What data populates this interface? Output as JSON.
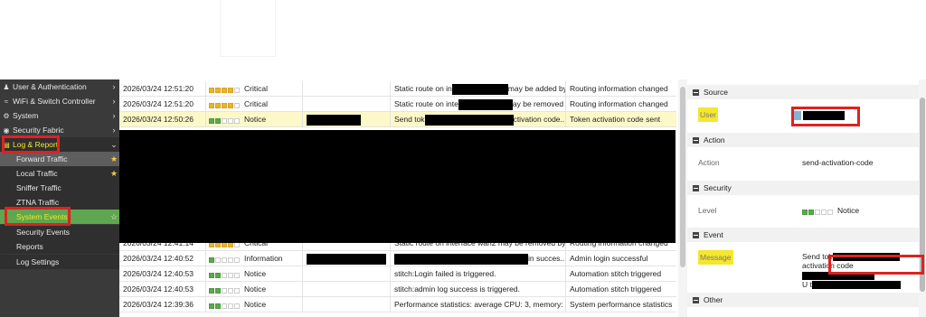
{
  "sidebar": {
    "items": [
      {
        "label": "User & Authentication",
        "icon": "user-icon",
        "has_chevron": true
      },
      {
        "label": "WiFi & Switch Controller",
        "icon": "wifi-icon",
        "has_chevron": true
      },
      {
        "label": "System",
        "icon": "gear-icon",
        "has_chevron": true
      },
      {
        "label": "Security Fabric",
        "icon": "fabric-icon",
        "has_chevron": true
      },
      {
        "label": "Log & Report",
        "icon": "chart-icon",
        "has_chevron": true
      }
    ],
    "sub_items": [
      {
        "label": "Forward Traffic",
        "starred": true
      },
      {
        "label": "Local Traffic",
        "starred": true
      },
      {
        "label": "Sniffer Traffic",
        "starred": false
      },
      {
        "label": "ZTNA Traffic",
        "starred": false
      },
      {
        "label": "System Events",
        "starred": true
      },
      {
        "label": "Security Events",
        "starred": false
      },
      {
        "label": "Reports",
        "starred": false
      },
      {
        "label": "Log Settings",
        "starred": false
      }
    ]
  },
  "events": {
    "rows": [
      {
        "date": "2026/03/24 12:51:20",
        "level": "Critical",
        "bars": 4,
        "user": "",
        "message_a": "Static route on in",
        "message_b": "may be added by he...",
        "action": "Routing information changed"
      },
      {
        "date": "2026/03/24 12:51:20",
        "level": "Critical",
        "bars": 4,
        "user": "",
        "message_a": "Static route on inte",
        "message_b": "ay be removed by ...",
        "action": "Routing information changed"
      },
      {
        "date": "2026/03/24 12:50:26",
        "level": "Notice",
        "bars": 2,
        "user": "",
        "message_a": "Send tok",
        "message_b": "ctivation code...",
        "action": "Token activation code sent"
      },
      {
        "date": "2026/03/24 12:41:14",
        "level": "Critical",
        "bars": 4,
        "user": "",
        "message_a": "Static route on interface wan2 may be removed by ...",
        "message_b": "",
        "action": "Routing information changed"
      },
      {
        "date": "2026/03/24 12:40:52",
        "level": "Information",
        "bars": 1,
        "user": "",
        "message_a": "",
        "message_b": "in succes...",
        "action": "Admin login successful"
      },
      {
        "date": "2026/03/24 12:40:53",
        "level": "Notice",
        "bars": 2,
        "user": "",
        "message_a": "stitch:Login failed is triggered.",
        "message_b": "",
        "action": "Automation stitch triggered"
      },
      {
        "date": "2026/03/24 12:40:53",
        "level": "Notice",
        "bars": 2,
        "user": "",
        "message_a": "stitch:admin log success is triggered.",
        "message_b": "",
        "action": "Automation stitch triggered"
      },
      {
        "date": "2026/03/24 12:39:36",
        "level": "Notice",
        "bars": 2,
        "user": "",
        "message_a": "Performance statistics: average CPU: 3, memory: 2...",
        "message_b": "",
        "action": "System performance statistics"
      }
    ]
  },
  "details": {
    "source_title": "Source",
    "user_label": "User",
    "action_title": "Action",
    "action_label": "Action",
    "action_value": "send-activation-code",
    "security_title": "Security",
    "level_label": "Level",
    "level_value": "Notice",
    "event_title": "Event",
    "message_label": "Message",
    "message_line1": "Send tok",
    "message_line2": "activation code",
    "message_line3": "U t",
    "other_title": "Other"
  },
  "colors": {
    "sidebar_bg": "#3a3a3a",
    "critical_bar": "#e8b52b",
    "notice_bar": "#5ea650",
    "highlight_row": "#fdf8c8",
    "annotation_red": "#dd2222",
    "active_item_bg": "#5ea650",
    "active_text": "#f5e72e"
  }
}
